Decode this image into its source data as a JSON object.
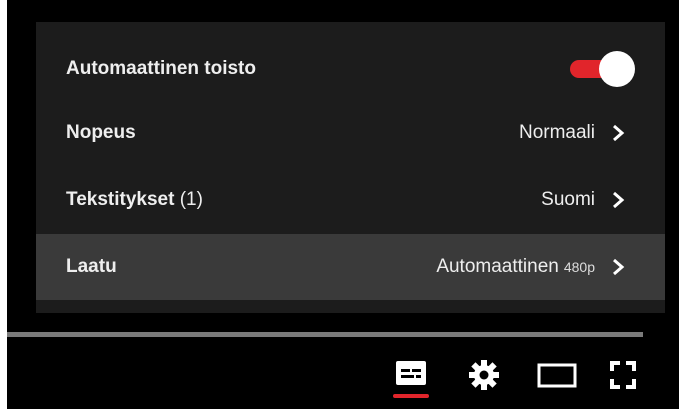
{
  "settings_menu": {
    "autoplay": {
      "label": "Automaattinen toisto",
      "enabled": true
    },
    "speed": {
      "label": "Nopeus",
      "value": "Normaali"
    },
    "subtitles": {
      "label": "Tekstitykset",
      "count": "(1)",
      "value": "Suomi"
    },
    "quality": {
      "label": "Laatu",
      "value": "Automaattinen",
      "resolution": "480p"
    }
  },
  "controls": {
    "subtitles_icon": "subtitles-icon",
    "settings_icon": "gear-icon",
    "theater_icon": "theater-mode-icon",
    "fullscreen_icon": "fullscreen-icon"
  },
  "colors": {
    "accent": "#e1252b",
    "menu_bg": "#1c1c1c",
    "selected_row_bg": "#3a3a3a"
  }
}
